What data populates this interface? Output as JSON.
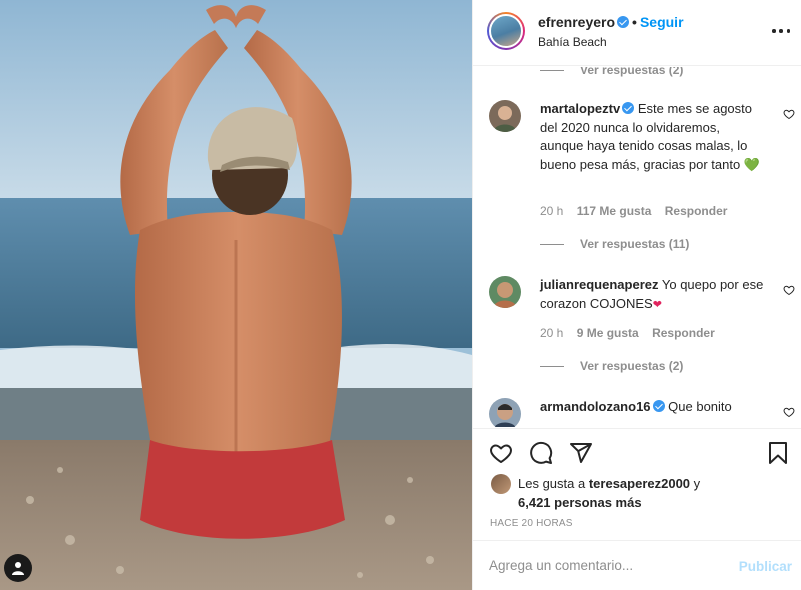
{
  "post": {
    "username": "efrenreyero",
    "follow_label": "Seguir",
    "location": "Bahía Beach",
    "more_icon": "more-horizontal-icon"
  },
  "comments": {
    "top_replies": "Ver respuestas (2)",
    "items": [
      {
        "username": "martalopeztv",
        "verified": true,
        "text": "Este mes se agosto del 2020 nunca lo olvidaremos, aunque haya tenido cosas malas, lo bueno pesa más, gracias por tanto",
        "emoji": "💚",
        "time": "20 h",
        "likes": "117 Me gusta",
        "reply_label": "Responder",
        "replies": "Ver respuestas (11)"
      },
      {
        "username": "julianrequenaperez",
        "verified": false,
        "text": "Yo quepo por ese corazon COJONES",
        "emoji": "❤",
        "time": "20 h",
        "likes": "9 Me gusta",
        "reply_label": "Responder",
        "replies": "Ver respuestas (2)"
      },
      {
        "username": "armandolozano16",
        "verified": true,
        "text": "Que bonito"
      }
    ]
  },
  "actions": {
    "like_icon": "heart-icon",
    "comment_icon": "comment-icon",
    "share_icon": "share-icon",
    "save_icon": "bookmark-icon"
  },
  "likes": {
    "prefix": "Les gusta a",
    "user": "teresaperez2000",
    "joiner": "y",
    "others": "6,421 personas más"
  },
  "time_ago": "HACE 20 HORAS",
  "add_comment": {
    "placeholder": "Agrega un comentario...",
    "publish_label": "Publicar"
  },
  "colors": {
    "link": "#0095f6",
    "verified": "#3897f0",
    "muted": "#8e8e8e",
    "publish_disabled": "#b2dffc"
  }
}
